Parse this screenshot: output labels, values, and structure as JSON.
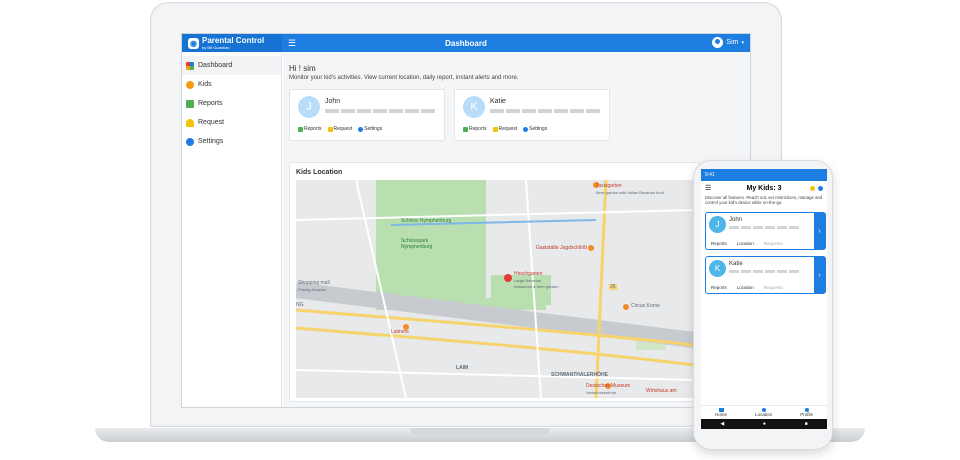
{
  "app": {
    "brand_title": "Parental Control",
    "brand_subtitle": "by Bit Guardian",
    "page_title": "Dashboard",
    "user_name": "Sim"
  },
  "sidebar": {
    "items": [
      {
        "label": "Dashboard",
        "icon": "dashboard-icon",
        "color": "#f0a020"
      },
      {
        "label": "Kids",
        "icon": "kids-icon",
        "color": "#f39c12"
      },
      {
        "label": "Reports",
        "icon": "reports-icon",
        "color": "#4caf50"
      },
      {
        "label": "Request",
        "icon": "bell-icon",
        "color": "#f4c20d"
      },
      {
        "label": "Settings",
        "icon": "gear-icon",
        "color": "#1e7de0"
      }
    ]
  },
  "main": {
    "greeting": "Hi ! sim",
    "subtitle": "Monitor your kid's activities. View current location, daily report, instant alerts and more.",
    "kids": [
      {
        "initial": "J",
        "name": "John"
      },
      {
        "initial": "K",
        "name": "Katie"
      }
    ],
    "actions": {
      "reports": "Reports",
      "request": "Request",
      "settings": "Settings"
    },
    "map_title": "Kids Location",
    "map_labels": {
      "park": "Schloss Nymphenburg",
      "garden": "Schlosspark Nymphenburg",
      "taxis": "Taxisgarten",
      "taxis_sub": "Beer garden with Italian Bavarian food",
      "jagd": "Gaststätte Jagdschlößl",
      "hirsch": "Hirschgarten",
      "hirsch_sub1": "Large Bavarian",
      "hirsch_sub2": "restaurant & beer garden",
      "mall": "Shopping mall",
      "mall_sub": "Pasing Arcaden",
      "laimers": "Laimers",
      "circus": "Circus Krone",
      "laim": "LAIM",
      "schwant": "SCHWANTHALERHÖHE",
      "museum": "Deutsches Museum",
      "museum_sub": "Verkehrszentrum",
      "wirts": "Wirtshaus am",
      "ng": "NG",
      "road": "26"
    }
  },
  "phone": {
    "time": "9:41",
    "title": "My Kids: 3",
    "desc": "Discover all features. Reach out, set restrictions, manage and control your kid's device while on-the-go.",
    "kids": [
      {
        "initial": "J",
        "name": "John"
      },
      {
        "initial": "K",
        "name": "Katie"
      }
    ],
    "actions": {
      "reports": "Reports",
      "location": "Location",
      "requests": "Requests"
    },
    "tabs": {
      "home": "Home",
      "location": "Location",
      "profile": "Profile"
    },
    "arrow": "›"
  }
}
